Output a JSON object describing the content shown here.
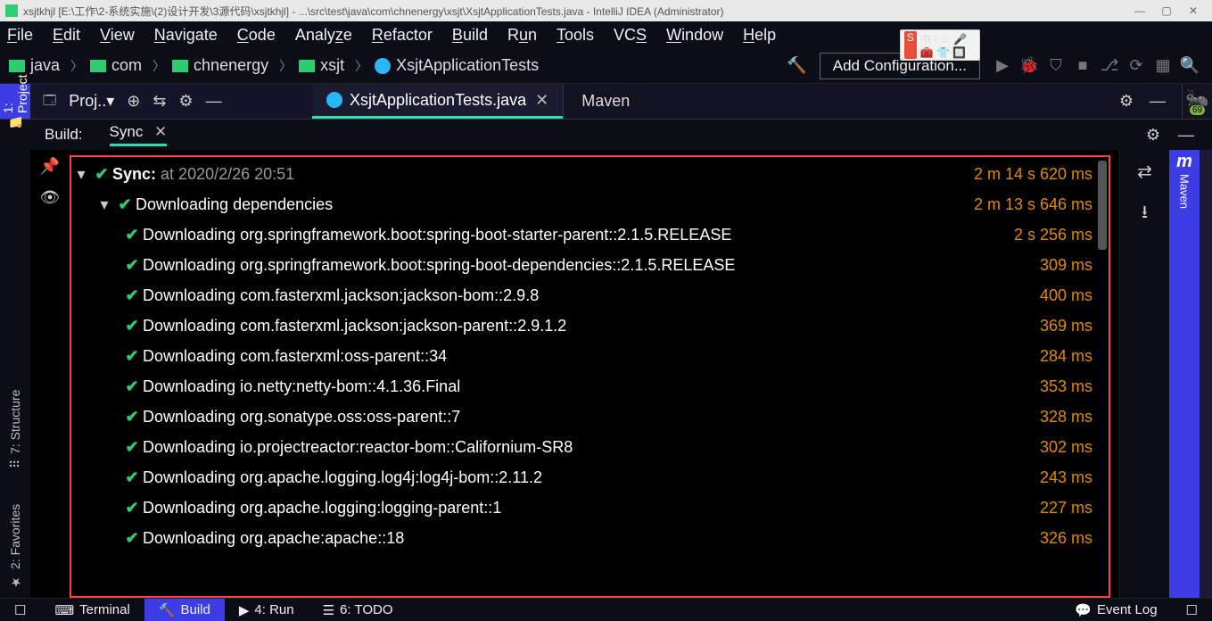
{
  "title": "xsjtkhjl [E:\\工作\\2-系统实施\\(2)设计开发\\3源代码\\xsjtkhjl] - ...\\src\\test\\java\\com\\chnenergy\\xsjt\\XsjtApplicationTests.java - IntelliJ IDEA (Administrator)",
  "menu": [
    "File",
    "Edit",
    "View",
    "Navigate",
    "Code",
    "Analyze",
    "Refactor",
    "Build",
    "Run",
    "Tools",
    "VCS",
    "Window",
    "Help"
  ],
  "breadcrumbs": {
    "b1": "java",
    "b2": "com",
    "b3": "chnenergy",
    "b4": "xsjt",
    "b5": "XsjtApplicationTests"
  },
  "toolbar": {
    "add_conf": "Add Configuration..."
  },
  "ime": {
    "s": "S",
    "items": "中 ⁞ ☺ 🎤 🧰 👕 🔲"
  },
  "proj": {
    "title": "Proj..▾"
  },
  "tab": {
    "file": "XsjtApplicationTests.java"
  },
  "maven": {
    "title": "Maven"
  },
  "ant": {
    "label": "Ant",
    "badge": "69"
  },
  "far_right": {
    "m": "m",
    "label": "Maven"
  },
  "build_head": {
    "build": "Build:",
    "sync": "Sync"
  },
  "sync_root": {
    "label": "Sync:",
    "ts": "at 2020/2/26 20:51",
    "time": "2 m 14 s 620 ms"
  },
  "dl_root": {
    "label": "Downloading dependencies",
    "time": "2 m 13 s 646 ms"
  },
  "items": [
    {
      "label": "Downloading org.springframework.boot:spring-boot-starter-parent::2.1.5.RELEASE",
      "time": "2 s 256 ms"
    },
    {
      "label": "Downloading org.springframework.boot:spring-boot-dependencies::2.1.5.RELEASE",
      "time": "309 ms"
    },
    {
      "label": "Downloading com.fasterxml.jackson:jackson-bom::2.9.8",
      "time": "400 ms"
    },
    {
      "label": "Downloading com.fasterxml.jackson:jackson-parent::2.9.1.2",
      "time": "369 ms"
    },
    {
      "label": "Downloading com.fasterxml:oss-parent::34",
      "time": "284 ms"
    },
    {
      "label": "Downloading io.netty:netty-bom::4.1.36.Final",
      "time": "353 ms"
    },
    {
      "label": "Downloading org.sonatype.oss:oss-parent::7",
      "time": "328 ms"
    },
    {
      "label": "Downloading io.projectreactor:reactor-bom::Californium-SR8",
      "time": "302 ms"
    },
    {
      "label": "Downloading org.apache.logging.log4j:log4j-bom::2.11.2",
      "time": "243 ms"
    },
    {
      "label": "Downloading org.apache.logging:logging-parent::1",
      "time": "227 ms"
    },
    {
      "label": "Downloading org.apache:apache::18",
      "time": "326 ms"
    }
  ],
  "left_rail": {
    "project": "1: Project",
    "favorites": "2: Favorites",
    "structure": "7: Structure"
  },
  "status": {
    "terminal": "Terminal",
    "build": "Build",
    "run": "4: Run",
    "todo": "6: TODO",
    "event": "Event Log"
  }
}
